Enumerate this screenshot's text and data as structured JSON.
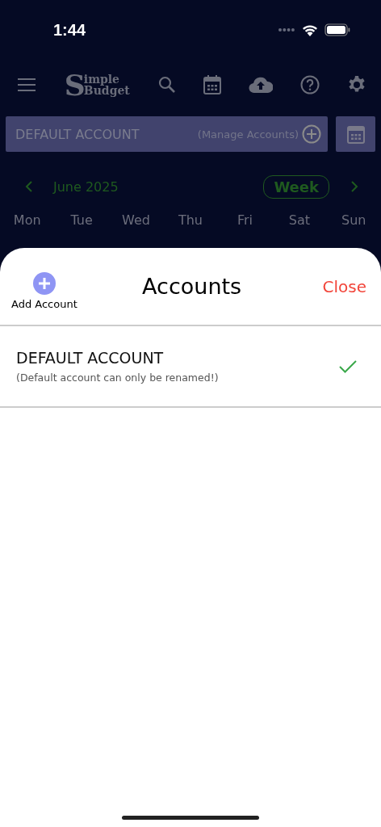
{
  "status_bar": {
    "time": "1:44"
  },
  "app_bar": {
    "logo": {
      "initial": "S",
      "line_1": "imple",
      "line_2": "Budget"
    }
  },
  "account_bar": {
    "account": "DEFAULT ACCOUNT",
    "manage": "(Manage Accounts)"
  },
  "calendar": {
    "month": "June 2025",
    "view": "Week",
    "weekdays": [
      "Mon",
      "Tue",
      "Wed",
      "Thu",
      "Fri",
      "Sat",
      "Sun"
    ]
  },
  "sheet": {
    "add_label": "Add Account",
    "title": "Accounts",
    "close": "Close",
    "accounts": [
      {
        "name": "DEFAULT ACCOUNT",
        "note": "(Default account can only be renamed!)",
        "selected": true
      }
    ]
  }
}
